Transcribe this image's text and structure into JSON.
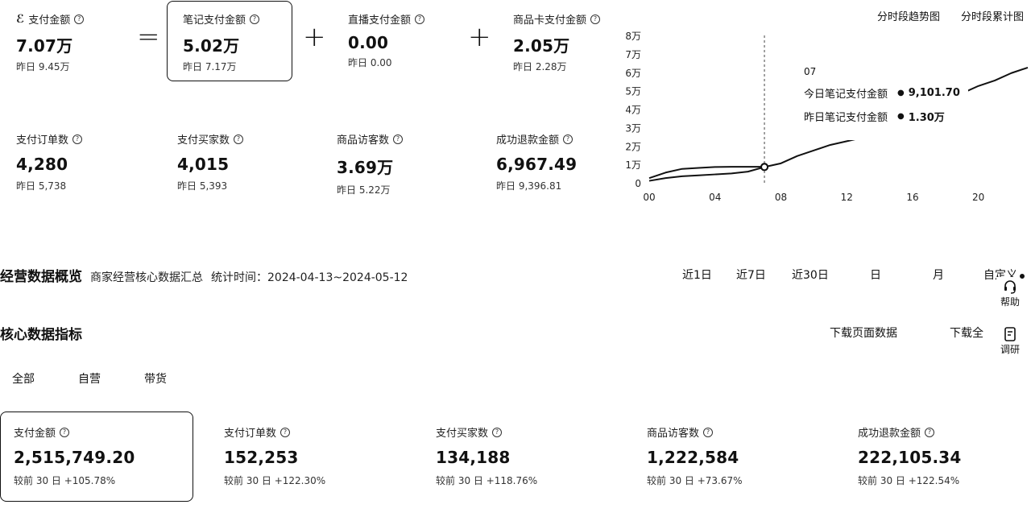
{
  "top_metrics": {
    "total": {
      "label": "支付金额",
      "value": "7.07万",
      "prev": "昨日 9.45万"
    },
    "equals": "=",
    "plus": "+",
    "note": {
      "label": "笔记支付金额",
      "value": "5.02万",
      "prev": "昨日 7.17万"
    },
    "live": {
      "label": "直播支付金额",
      "value": "0.00",
      "prev": "昨日 0.00"
    },
    "card": {
      "label": "商品卡支付金额",
      "value": "2.05万",
      "prev": "昨日 2.28万"
    },
    "orders": {
      "label": "支付订单数",
      "value": "4,280",
      "prev": "昨日 5,738"
    },
    "buyers": {
      "label": "支付买家数",
      "value": "4,015",
      "prev": "昨日 5,393"
    },
    "visitors": {
      "label": "商品访客数",
      "value": "3.69万",
      "prev": "昨日 5.22万"
    },
    "refund": {
      "label": "成功退款金额",
      "value": "6,967.49",
      "prev": "昨日 9,396.81"
    }
  },
  "chart_tabs": {
    "trend": "分时段趋势图",
    "cumulative": "分时段累计图"
  },
  "chart_data": {
    "type": "line",
    "y_ticks": [
      "8万",
      "7万",
      "6万",
      "5万",
      "4万",
      "3万",
      "2万",
      "1万",
      "0"
    ],
    "x_ticks": [
      "00",
      "04",
      "08",
      "12",
      "16",
      "20"
    ],
    "ylim": [
      0,
      80000
    ],
    "xlim": [
      0,
      23
    ],
    "series": [
      {
        "name": "今日笔记支付金额",
        "x": [
          0,
          1,
          2,
          3,
          4,
          5,
          6,
          7
        ],
        "values": [
          3000,
          6000,
          8000,
          8500,
          9000,
          9100,
          9100,
          9101.7
        ]
      },
      {
        "name": "昨日笔记支付金额",
        "x": [
          0,
          1,
          2,
          3,
          4,
          5,
          6,
          7,
          8,
          9,
          10,
          11,
          12,
          13,
          14,
          15,
          16,
          17,
          18,
          19,
          20,
          21,
          22,
          23
        ],
        "values": [
          1500,
          3000,
          4000,
          4500,
          5000,
          5500,
          6500,
          9000,
          11000,
          15000,
          18000,
          21000,
          23000,
          25000,
          26000,
          26500,
          27000,
          27500,
          28000,
          49000,
          53000,
          56000,
          60000,
          63000
        ]
      }
    ],
    "tooltip": {
      "title": "07",
      "rows": [
        {
          "label": "今日笔记支付金额",
          "value": "9,101.70"
        },
        {
          "label": "昨日笔记支付金额",
          "value": "1.30万"
        }
      ]
    }
  },
  "overview": {
    "title": "经营数据概览",
    "desc": "商家经营核心数据汇总",
    "range": "统计时间：2024-04-13~2024-05-12",
    "ranges": [
      "近1日",
      "近7日",
      "近30日",
      "日",
      "月",
      "自定义"
    ]
  },
  "side": {
    "help": "帮助",
    "survey": "调研"
  },
  "core": {
    "title": "核心数据指标",
    "download_page": "下载页面数据",
    "download_all": "下载全",
    "tabs": [
      "全部",
      "自营",
      "带货"
    ],
    "cards": [
      {
        "label": "支付金额",
        "value": "2,515,749.20",
        "cmp": "较前 30 日 +105.78%"
      },
      {
        "label": "支付订单数",
        "value": "152,253",
        "cmp": "较前 30 日 +122.30%"
      },
      {
        "label": "支付买家数",
        "value": "134,188",
        "cmp": "较前 30 日 +118.76%"
      },
      {
        "label": "商品访客数",
        "value": "1,222,584",
        "cmp": "较前 30 日 +73.67%"
      },
      {
        "label": "成功退款金额",
        "value": "222,105.34",
        "cmp": "较前 30 日 +122.54%"
      }
    ]
  }
}
